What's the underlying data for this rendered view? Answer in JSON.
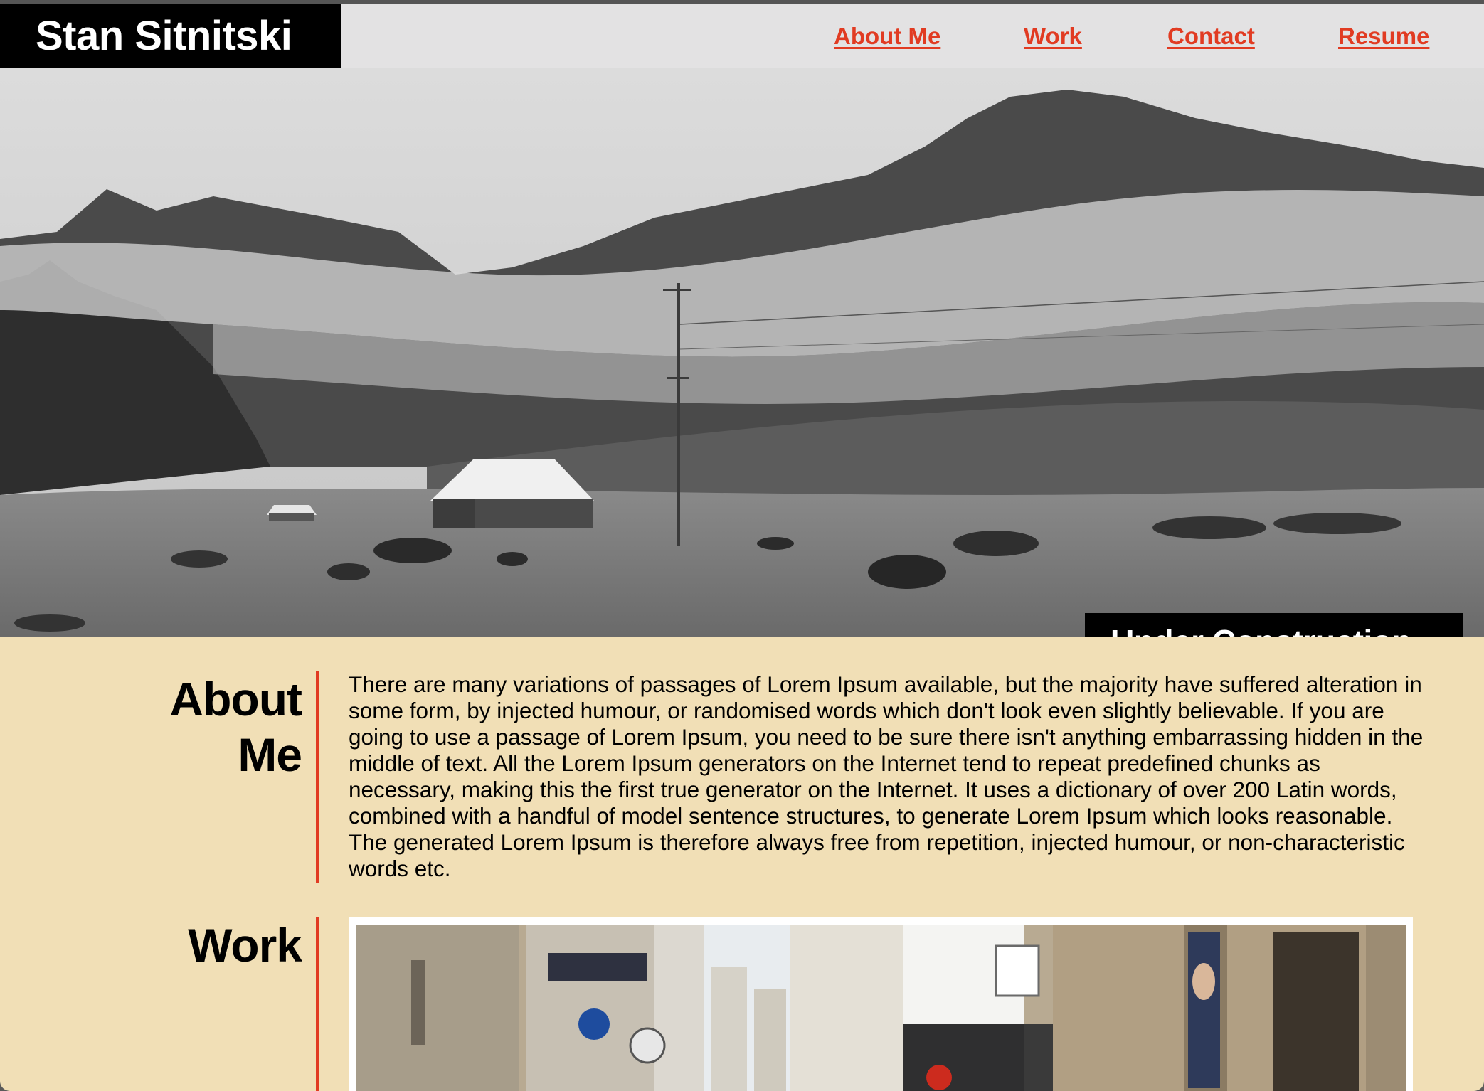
{
  "header": {
    "brand": "Stan Sitnitski",
    "nav": [
      "About Me",
      "Work",
      "Contact",
      "Resume"
    ]
  },
  "hero": {
    "badge": "Under Construction..."
  },
  "about": {
    "title": "About Me",
    "text": "There are many variations of passages of Lorem Ipsum available, but the majority have suffered alteration in some form, by injected humour, or randomised words which don't look even slightly believable. If you are going to use a passage of Lorem Ipsum, you need to be sure there isn't anything embarrassing hidden in the middle of text. All the Lorem Ipsum generators on the Internet tend to repeat predefined chunks as necessary, making this the first true generator on the Internet. It uses a dictionary of over 200 Latin words, combined with a handful of model sentence structures, to generate Lorem Ipsum which looks reasonable. The generated Lorem Ipsum is therefore always free from repetition, injected humour, or non-characteristic words etc."
  },
  "work": {
    "title": "Work"
  },
  "colors": {
    "accent": "#e13b22",
    "background": "#f1dfb6",
    "header": "#e3e2e3",
    "brand_bg": "#000000"
  },
  "icons": {
    "hero_image": "foggy-hillside-barn-photo",
    "work_image": "paris-street-photo"
  }
}
